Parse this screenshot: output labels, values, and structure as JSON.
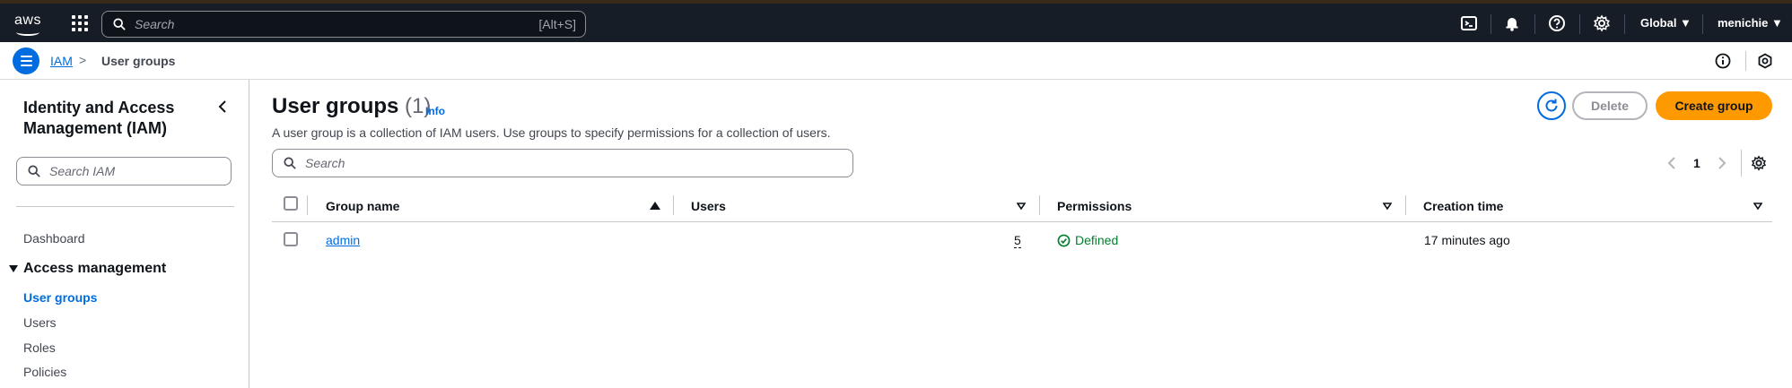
{
  "topnav": {
    "logo_text": "aws",
    "search_placeholder": "Search",
    "search_shortcut": "[Alt+S]",
    "region": "Global ▼",
    "account": "menichie ▼"
  },
  "breadcrumb": {
    "root": "IAM",
    "separator": ">",
    "current": "User groups"
  },
  "sidebar": {
    "title": "Identity and Access Management (IAM)",
    "search_placeholder": "Search IAM",
    "dashboard": "Dashboard",
    "section_title": "Access management",
    "items": [
      {
        "label": "User groups",
        "active": true
      },
      {
        "label": "Users",
        "active": false
      },
      {
        "label": "Roles",
        "active": false
      },
      {
        "label": "Policies",
        "active": false
      }
    ]
  },
  "main": {
    "title": "User groups",
    "count": "(1)",
    "info": "Info",
    "description": "A user group is a collection of IAM users. Use groups to specify permissions for a collection of users.",
    "delete_label": "Delete",
    "create_label": "Create group",
    "search_placeholder": "Search",
    "page_number": "1"
  },
  "table": {
    "columns": [
      "Group name",
      "Users",
      "Permissions",
      "Creation time"
    ],
    "rows": [
      {
        "group_name": "admin",
        "users": "5",
        "permissions": "Defined",
        "creation_time": "17 minutes ago"
      }
    ]
  },
  "colors": {
    "nav_bg": "#161d26",
    "link": "#006ce0",
    "primary_button": "#ff9900",
    "success": "#00802f"
  },
  "icons": [
    "apps-grid-icon",
    "search-icon",
    "cloudshell-icon",
    "bell-icon",
    "help-icon",
    "gear-icon",
    "menu-icon",
    "info-icon",
    "feedback-icon",
    "chevron-left-icon",
    "refresh-icon",
    "check-circle-icon"
  ]
}
